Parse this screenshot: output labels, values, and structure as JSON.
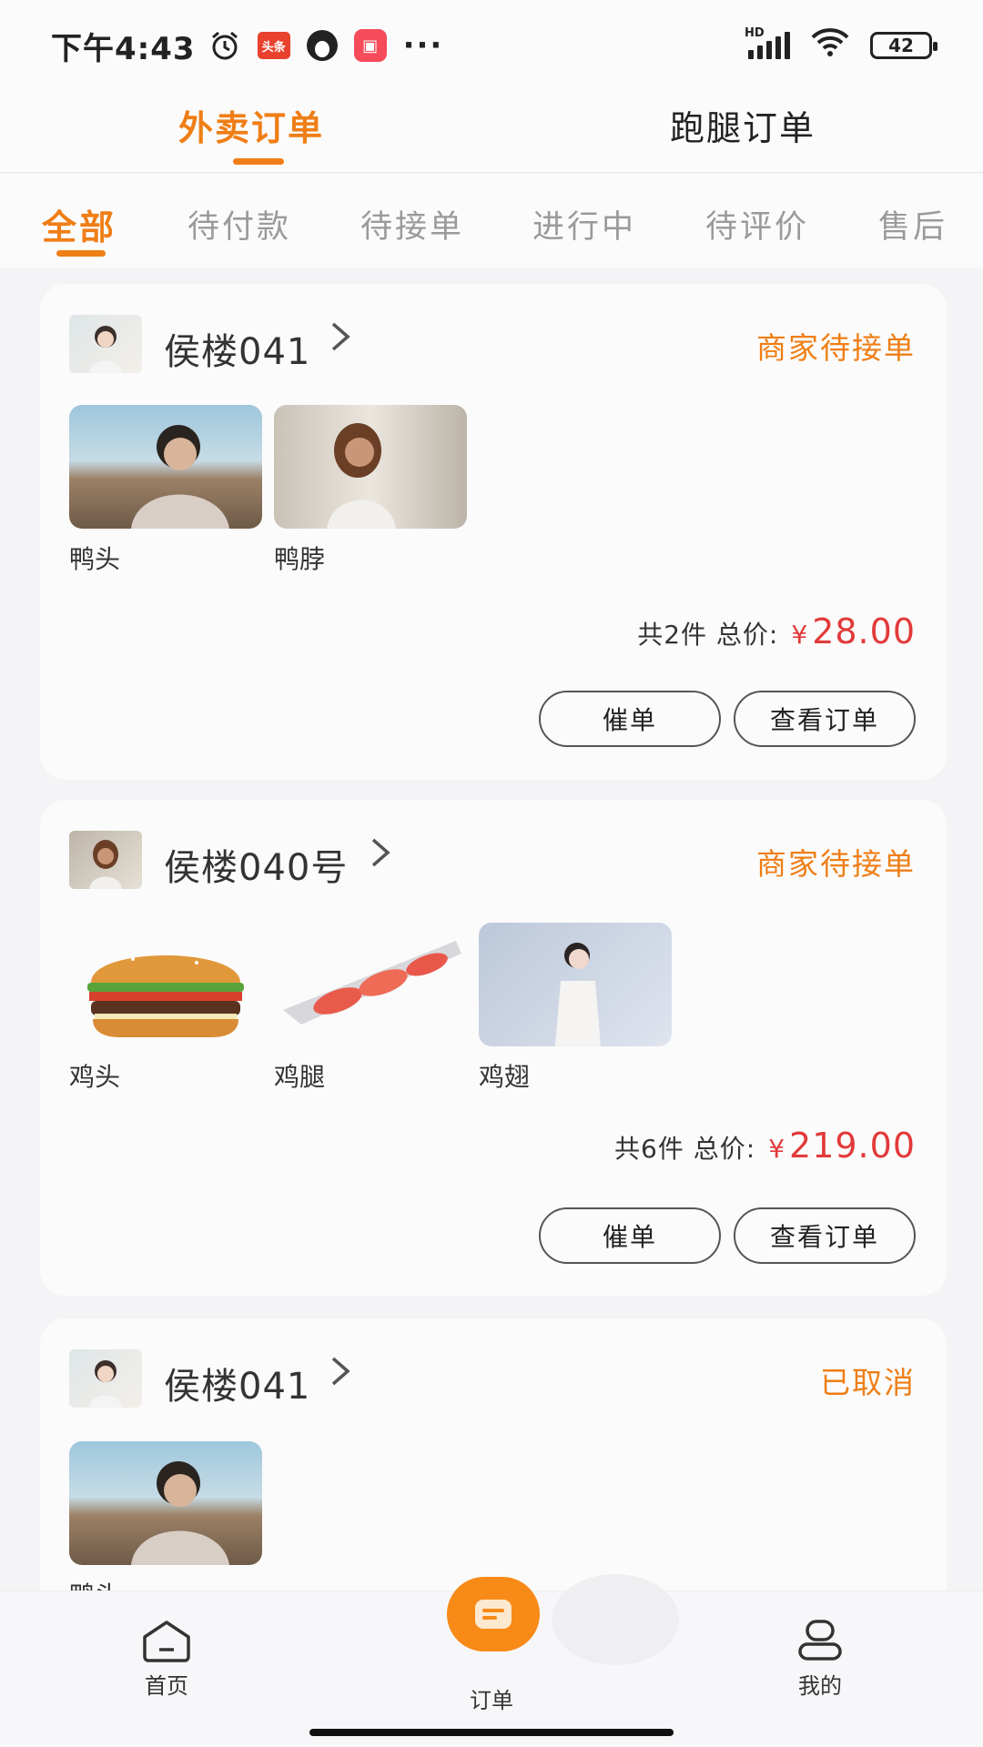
{
  "status_bar": {
    "time": "下午4:43",
    "app_badge_text": "头条",
    "battery": "42",
    "signal_label": "HD"
  },
  "top_tabs": [
    {
      "label": "外卖订单",
      "active": true
    },
    {
      "label": "跑腿订单",
      "active": false
    }
  ],
  "sub_tabs": [
    {
      "label": "全部",
      "active": true
    },
    {
      "label": "待付款",
      "active": false
    },
    {
      "label": "待接单",
      "active": false
    },
    {
      "label": "进行中",
      "active": false
    },
    {
      "label": "待评价",
      "active": false
    },
    {
      "label": "售后",
      "active": false
    }
  ],
  "orders": [
    {
      "store": "侯楼041",
      "status": "商家待接单",
      "items": [
        {
          "name": "鸭头",
          "image": "man-photo"
        },
        {
          "name": "鸭脖",
          "image": "woman-street-photo"
        }
      ],
      "summary": "共2件 总价:",
      "currency": "¥",
      "price": "28.00",
      "buttons": [
        "催单",
        "查看订单"
      ]
    },
    {
      "store": "侯楼040号",
      "status": "商家待接单",
      "items": [
        {
          "name": "鸡头",
          "image": "burger-photo"
        },
        {
          "name": "鸡腿",
          "image": "sushi-photo"
        },
        {
          "name": "鸡翅",
          "image": "woman-portrait-photo"
        }
      ],
      "summary": "共6件 总价:",
      "currency": "¥",
      "price": "219.00",
      "buttons": [
        "催单",
        "查看订单"
      ]
    },
    {
      "store": "侯楼041",
      "status": "已取消",
      "items": [
        {
          "name": "鸭头",
          "image": "man-photo"
        }
      ]
    }
  ],
  "bottom_nav": [
    {
      "label": "首页",
      "icon": "home-icon"
    },
    {
      "label": "订单",
      "icon": "order-icon",
      "active": true
    },
    {
      "label": "我的",
      "icon": "profile-icon"
    }
  ],
  "colors": {
    "accent": "#ef7e16",
    "price": "#e23a3a",
    "background": "#f4f4f6",
    "card": "#fbfbfb"
  }
}
